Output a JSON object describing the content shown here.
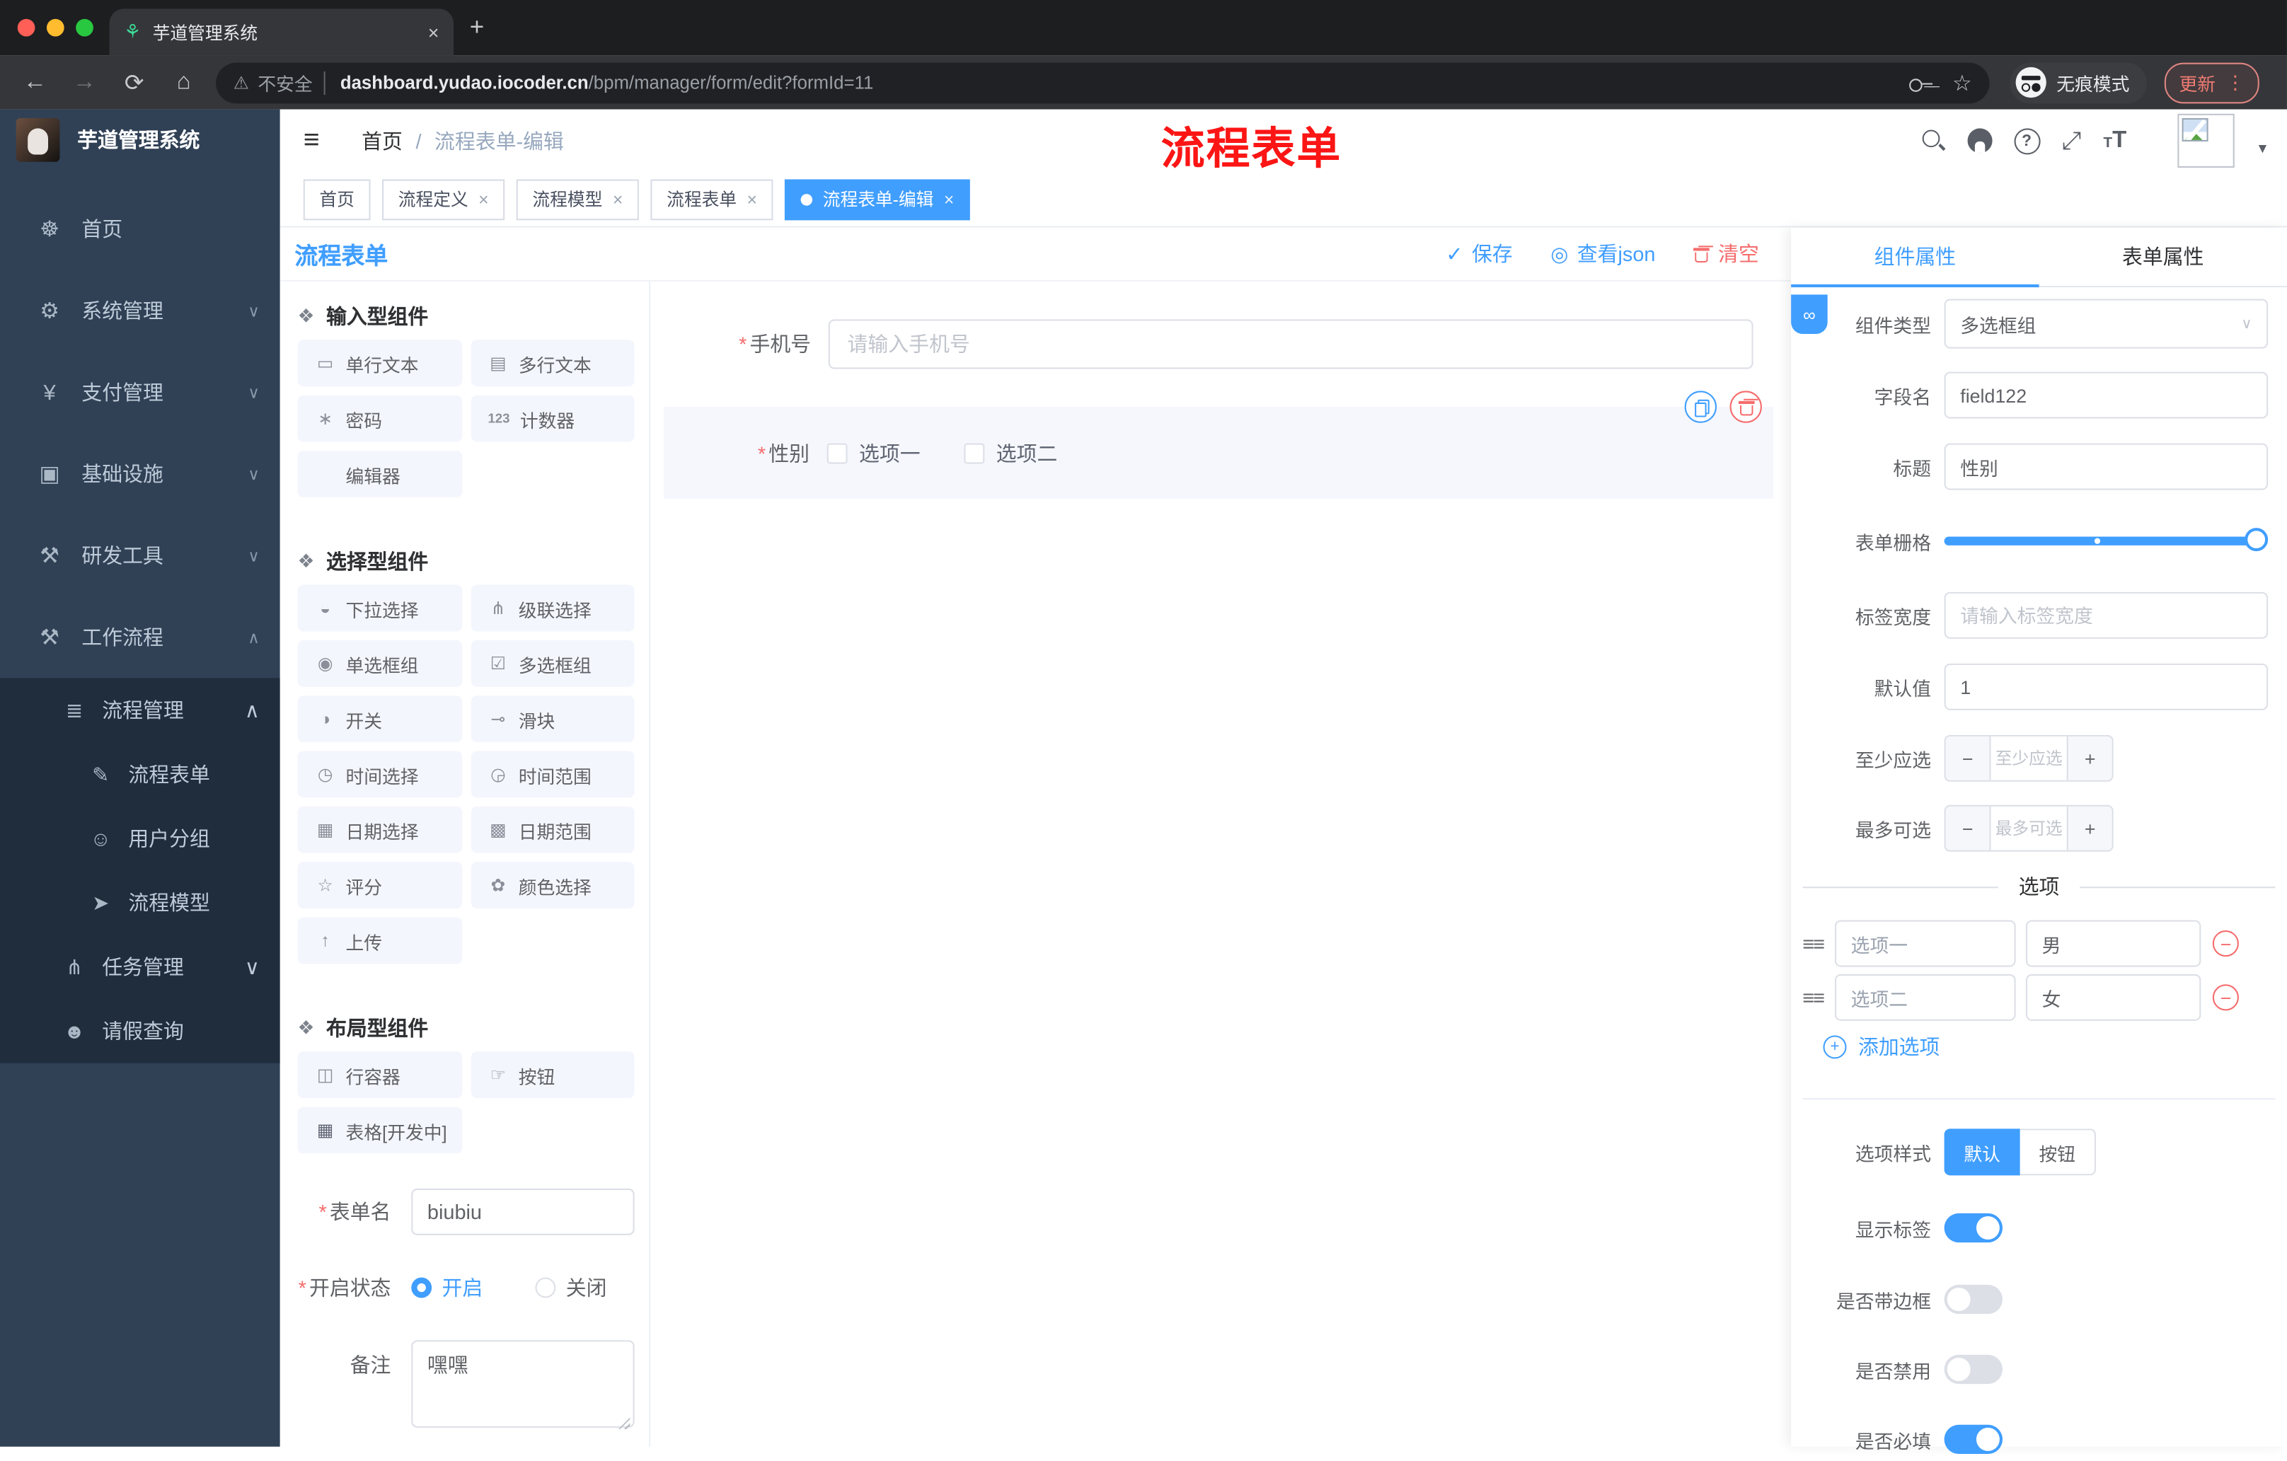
{
  "colors": {
    "primary": "#409EFF",
    "danger": "#F56C6C"
  },
  "browser": {
    "tab_title": "芋道管理系统",
    "security_label": "不安全",
    "url_host": "dashboard.yudao.iocoder.cn",
    "url_path": "/bpm/manager/form/edit?formId=11",
    "incognito_label": "无痕模式",
    "update_label": "更新"
  },
  "icons": {
    "plant": "⚘",
    "close": "×",
    "plus": "+",
    "back": "←",
    "forward": "→",
    "reload": "⟳",
    "home": "⌂",
    "warn": "⚠",
    "star": "☆",
    "dots": "⋮",
    "caret": "▾",
    "hamburger": "≡",
    "help": "?",
    "fullscreen": "⤢",
    "font_small": "T",
    "font_big": "T",
    "save_check": "✓",
    "view_eye": "◎",
    "puzzle": "❖",
    "chevron_down": "∨",
    "chevron_up": "∧",
    "link": "∞",
    "select_caret": "∨",
    "drag": "≡≡",
    "minus": "−",
    "stepper_minus": "−",
    "stepper_plus": "+",
    "required_mark": "*"
  },
  "sidebar": {
    "logo_title": "芋道管理系统",
    "items": [
      {
        "label": "首页",
        "icon": "☸"
      },
      {
        "label": "系统管理",
        "icon": "⚙"
      },
      {
        "label": "支付管理",
        "icon": "¥"
      },
      {
        "label": "基础设施",
        "icon": "▣"
      },
      {
        "label": "研发工具",
        "icon": "⚒"
      },
      {
        "label": "工作流程",
        "icon": "⚒"
      }
    ],
    "submenu": [
      {
        "label": "流程管理",
        "icon": "≣"
      },
      {
        "label": "流程表单",
        "icon": "✎"
      },
      {
        "label": "用户分组",
        "icon": "☺"
      },
      {
        "label": "流程模型",
        "icon": "➤"
      },
      {
        "label": "任务管理",
        "icon": "⋔"
      },
      {
        "label": "请假查询",
        "icon": "☻"
      }
    ]
  },
  "header": {
    "breadcrumb_home": "首页",
    "breadcrumb_sep": "/",
    "breadcrumb_current": "流程表单-编辑",
    "annotation": "流程表单"
  },
  "tags": {
    "items": [
      {
        "label": "首页"
      },
      {
        "label": "流程定义"
      },
      {
        "label": "流程模型"
      },
      {
        "label": "流程表单"
      },
      {
        "label": "流程表单-编辑"
      }
    ]
  },
  "designer": {
    "title": "流程表单",
    "save_label": "保存",
    "view_json_label": "查看json",
    "clear_label": "清空"
  },
  "components": {
    "group_input": {
      "title": "输入型组件",
      "items": [
        {
          "icon": "▭",
          "label": "单行文本"
        },
        {
          "icon": "▤",
          "label": "多行文本"
        },
        {
          "icon": "∗",
          "label": "密码"
        },
        {
          "icon": "123",
          "label": "计数器"
        },
        {
          "icon": "",
          "label": "编辑器"
        }
      ]
    },
    "group_select": {
      "title": "选择型组件",
      "items": [
        {
          "icon": "◒",
          "label": "下拉选择"
        },
        {
          "icon": "⋔",
          "label": "级联选择"
        },
        {
          "icon": "◉",
          "label": "单选框组"
        },
        {
          "icon": "☑",
          "label": "多选框组"
        },
        {
          "icon": "◑",
          "label": "开关"
        },
        {
          "icon": "⊸",
          "label": "滑块"
        },
        {
          "icon": "◷",
          "label": "时间选择"
        },
        {
          "icon": "◶",
          "label": "时间范围"
        },
        {
          "icon": "▦",
          "label": "日期选择"
        },
        {
          "icon": "▩",
          "label": "日期范围"
        },
        {
          "icon": "☆",
          "label": "评分"
        },
        {
          "icon": "✿",
          "label": "颜色选择"
        },
        {
          "icon": "↑",
          "label": "上传"
        }
      ]
    },
    "group_layout": {
      "title": "布局型组件",
      "items": [
        {
          "icon": "◫",
          "label": "行容器"
        },
        {
          "icon": "☞",
          "label": "按钮"
        },
        {
          "icon": "▦",
          "label": "表格[开发中]"
        }
      ]
    }
  },
  "form_settings": {
    "name_label": "表单名",
    "name_value": "biubiu",
    "status_label": "开启状态",
    "status_on": "开启",
    "status_off": "关闭",
    "remark_label": "备注",
    "remark_value": "嘿嘿"
  },
  "canvas": {
    "phone_label": "手机号",
    "phone_placeholder": "请输入手机号",
    "gender_label": "性别",
    "gender_option1": "选项一",
    "gender_option2": "选项二"
  },
  "panel": {
    "tab_component": "组件属性",
    "tab_form": "表单属性",
    "type_label": "组件类型",
    "type_value": "多选框组",
    "field_label": "字段名",
    "field_value": "field122",
    "title_label": "标题",
    "title_value": "性别",
    "grid_label": "表单栅格",
    "width_label": "标签宽度",
    "width_placeholder": "请输入标签宽度",
    "default_label": "默认值",
    "default_value": "1",
    "min_label": "至少应选",
    "min_placeholder": "至少应选",
    "max_label": "最多可选",
    "max_placeholder": "最多可选",
    "options": {
      "title": "选项",
      "rows": [
        {
          "label": "选项一",
          "value": "男"
        },
        {
          "label": "选项二",
          "value": "女"
        }
      ],
      "add_label": "添加选项"
    },
    "style_label": "选项样式",
    "style_default": "默认",
    "style_button": "按钮",
    "toggles": [
      {
        "label": "显示标签"
      },
      {
        "label": "是否带边框"
      },
      {
        "label": "是否禁用"
      },
      {
        "label": "是否必填"
      }
    ]
  }
}
